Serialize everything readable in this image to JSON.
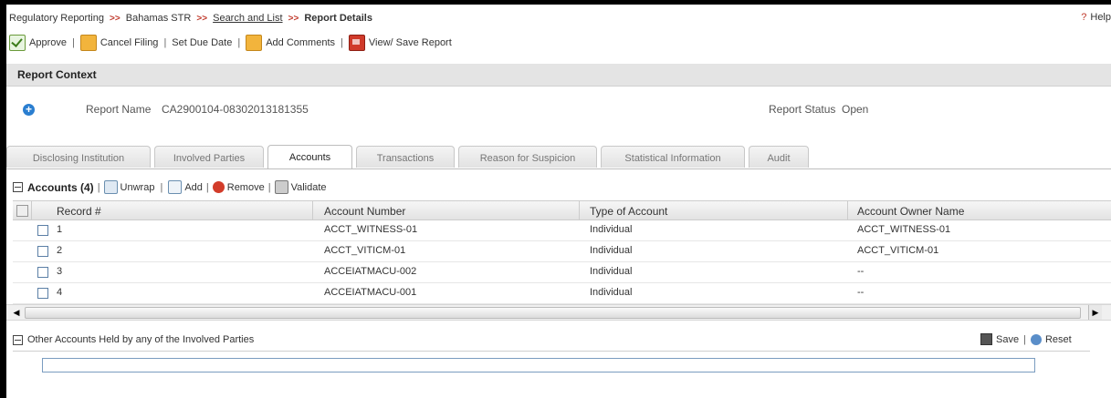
{
  "breadcrumb": {
    "item1": "Regulatory Reporting",
    "sep": ">>",
    "item2": "Bahamas STR",
    "item3": "Search and List",
    "item4": "Report Details"
  },
  "help": {
    "icon": "?",
    "label": "Help"
  },
  "toolbar": {
    "approve": "Approve",
    "cancel_filing": "Cancel Filing",
    "set_due_date": "Set Due Date",
    "add_comments": "Add Comments",
    "view_save": "View/ Save Report",
    "sep": "|"
  },
  "context": {
    "title": "Report Context",
    "report_name_label": "Report Name",
    "report_name_value": "CA2900104-08302013181355",
    "report_status_label": "Report Status",
    "report_status_value": "Open"
  },
  "tabs": [
    "Disclosing Institution",
    "Involved Parties",
    "Accounts",
    "Transactions",
    "Reason for Suspicion",
    "Statistical Information",
    "Audit"
  ],
  "accounts": {
    "title": "Accounts (4)",
    "unwrap": "Unwrap",
    "add": "Add",
    "remove": "Remove",
    "validate": "Validate",
    "sep": "|",
    "columns": [
      "Record #",
      "Account Number",
      "Type of Account",
      "Account Owner Name"
    ],
    "rows": [
      {
        "record": "1",
        "number": "ACCT_WITNESS-01",
        "type": "Individual",
        "owner": "ACCT_WITNESS-01"
      },
      {
        "record": "2",
        "number": "ACCT_VITICM-01",
        "type": "Individual",
        "owner": "ACCT_VITICM-01"
      },
      {
        "record": "3",
        "number": "ACCEIATMACU-002",
        "type": "Individual",
        "owner": "--"
      },
      {
        "record": "4",
        "number": "ACCEIATMACU-001",
        "type": "Individual",
        "owner": "--"
      }
    ]
  },
  "other_accounts": {
    "title": "Other Accounts Held by any of the Involved Parties",
    "save": "Save",
    "reset": "Reset",
    "sep": "|"
  },
  "colors": {
    "breadcrumb_sep": "#c0392b",
    "context_header_bg": "#e4e4e4",
    "plus_icon": "#2a7ed0"
  }
}
